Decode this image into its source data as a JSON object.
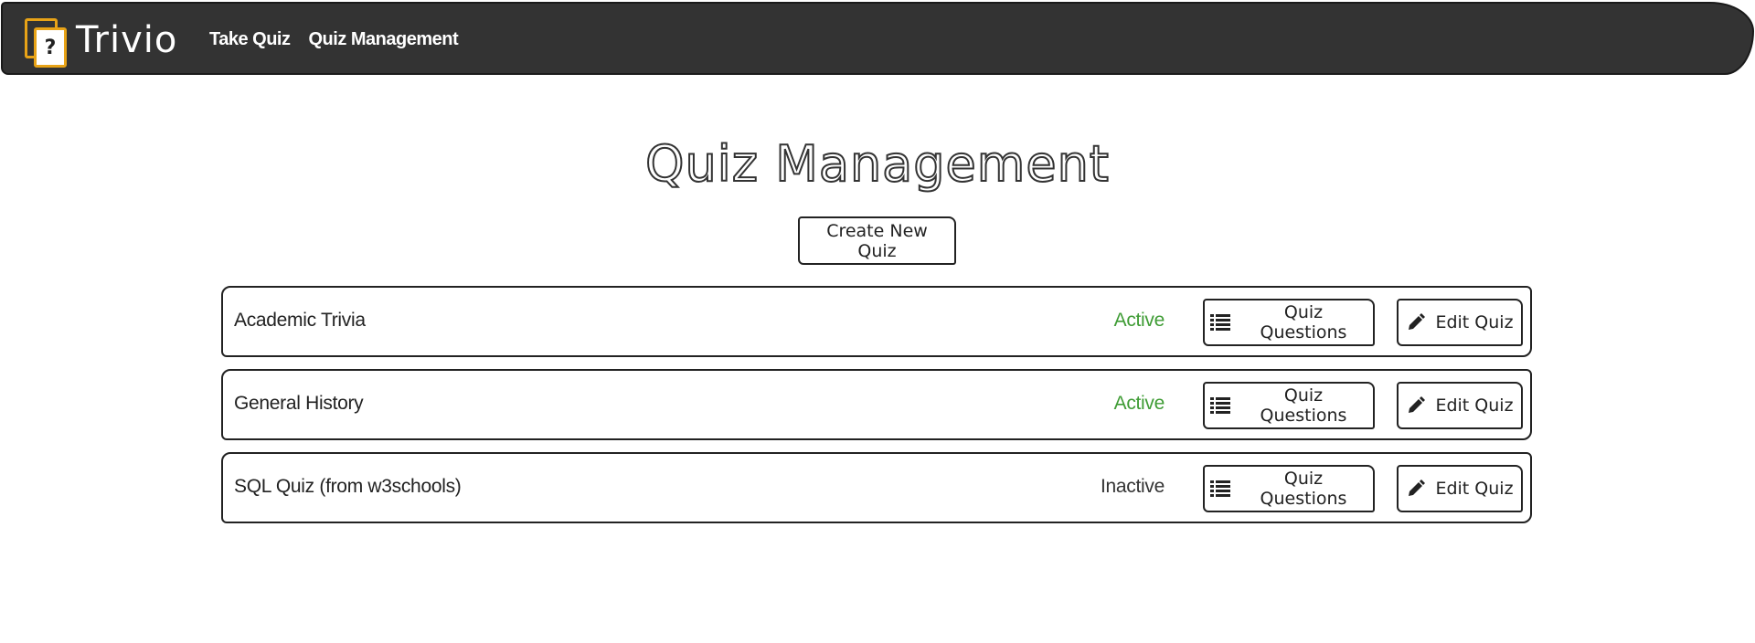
{
  "navbar": {
    "brand_name": "Trivio",
    "logo_glyph": "?",
    "logo_color": "#e8a317",
    "background_color": "#333333",
    "links": [
      {
        "label": "Take Quiz"
      },
      {
        "label": "Quiz Management"
      }
    ]
  },
  "main": {
    "title": "Quiz Management",
    "create_button_label": "Create New Quiz",
    "quizzes": [
      {
        "name": "Academic Trivia",
        "status": "Active",
        "status_color": "#3f9c35",
        "questions_label": "Quiz Questions",
        "questions_icon": "list-icon",
        "edit_label": "Edit Quiz",
        "edit_icon": "pencil-icon"
      },
      {
        "name": "General History",
        "status": "Active",
        "status_color": "#3f9c35",
        "questions_label": "Quiz Questions",
        "questions_icon": "list-icon",
        "edit_label": "Edit Quiz",
        "edit_icon": "pencil-icon"
      },
      {
        "name": "SQL Quiz (from w3schools)",
        "status": "Inactive",
        "status_color": "#333333",
        "questions_label": "Quiz Questions",
        "questions_icon": "list-icon",
        "edit_label": "Edit Quiz",
        "edit_icon": "pencil-icon"
      }
    ]
  }
}
